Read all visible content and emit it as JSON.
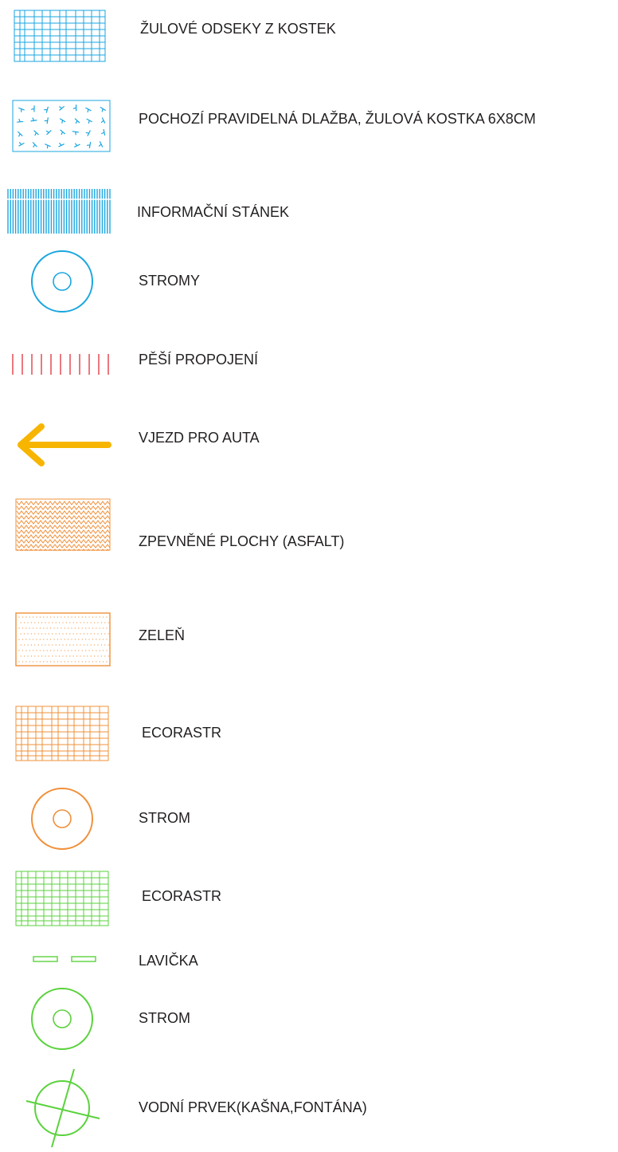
{
  "legend": {
    "items": [
      {
        "label": "ŽULOVÉ ODSEKY Z KOSTEK",
        "symbol": "grid-hatch-icon",
        "color": "#1aa6e0"
      },
      {
        "label": "POCHOZÍ  PRAVIDELNÁ DLAŽBA, ŽULOVÁ KOSTKA 6X8CM",
        "symbol": "random-tick-pattern-icon",
        "color": "#1aa6e0"
      },
      {
        "label": "INFORMAČNÍ STÁNEK",
        "symbol": "vertical-stripe-hatch-icon",
        "color": "#1aa6e0"
      },
      {
        "label": "STROMY",
        "symbol": "tree-circle-icon",
        "color": "#1aa6e0"
      },
      {
        "label": "PĚŠÍ PROPOJENÍ",
        "symbol": "dashed-vertical-lines-icon",
        "color": "#e0303a"
      },
      {
        "label": "VJEZD PRO AUTA",
        "symbol": "left-arrow-icon",
        "color": "#f7b500"
      },
      {
        "label": "ZPEVNĚNÉ PLOCHY (ASFALT)",
        "symbol": "zigzag-hatch-icon",
        "color": "#f0903a"
      },
      {
        "label": "ZELEŇ",
        "symbol": "dot-pattern-icon",
        "color": "#f0903a"
      },
      {
        "label": "ECORASTR",
        "symbol": "grid-hatch-icon",
        "color": "#f0903a"
      },
      {
        "label": "STROM",
        "symbol": "tree-circle-icon",
        "color": "#f0903a"
      },
      {
        "label": "ECORASTR",
        "symbol": "grid-hatch-icon",
        "color": "#5ad23c"
      },
      {
        "label": "LAVIČKA",
        "symbol": "bench-icon",
        "color": "#5ad23c"
      },
      {
        "label": "STROM",
        "symbol": "tree-circle-icon",
        "color": "#5ad23c"
      },
      {
        "label": "VODNÍ PRVEK(KAŠNA,FONTÁNA)",
        "symbol": "crossed-circle-icon",
        "color": "#5ad23c"
      }
    ]
  }
}
